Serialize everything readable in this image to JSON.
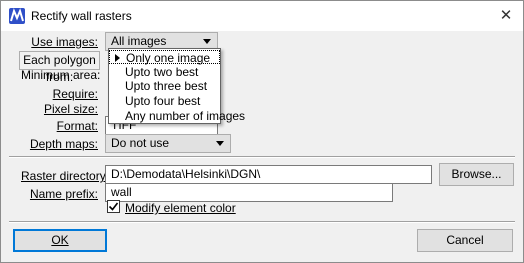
{
  "window": {
    "title": "Rectify wall rasters",
    "close_glyph": "✕"
  },
  "form": {
    "use_images": {
      "label": "Use images:",
      "value": "All images"
    },
    "each_polygon": {
      "label": "Each polygon from:"
    },
    "minimum_area": {
      "label": "Minimum area:"
    },
    "require": {
      "label": "Require:"
    },
    "pixel_size": {
      "label": "Pixel size:"
    },
    "format": {
      "label": "Format:",
      "value": "TIFF"
    },
    "depth_maps": {
      "label": "Depth maps:",
      "value": "Do not use"
    },
    "raster_directory": {
      "label": "Raster directory:",
      "value": "D:\\Demodata\\Helsinki\\DGN\\"
    },
    "name_prefix": {
      "label": "Name prefix:",
      "value": "wall"
    },
    "modify_color": {
      "label": "Modify element color",
      "checked": true
    }
  },
  "dropdown": {
    "items": [
      "Only one image",
      "Upto two best",
      "Upto three best",
      "Upto four best",
      "Any number of images"
    ],
    "selected_index": 0
  },
  "buttons": {
    "browse": "Browse...",
    "ok": "OK",
    "cancel": "Cancel"
  },
  "colors": {
    "accent": "#0078d7",
    "app_icon": "#2f4fc8"
  }
}
